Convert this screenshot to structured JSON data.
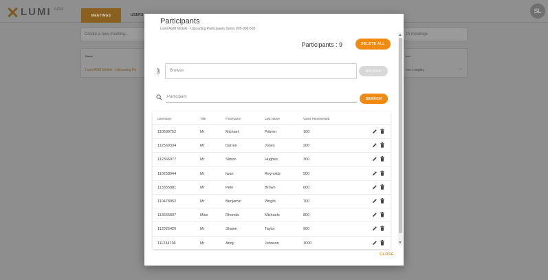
{
  "header": {
    "logo_text": "LUMI",
    "logo_sup": "AGM",
    "nav_meetings": "MEETINGS",
    "nav_users": "USERS",
    "avatar_initials": "SL"
  },
  "background": {
    "search_placeholder": "Create a new meeting...",
    "search_right_placeholder": "th meetings",
    "table_header": "Name",
    "table_row": "Lumi AGM Mobile - Uploading Pa",
    "table_header_right": "iner",
    "table_row_right": "eve Longley",
    "row_menu": "···"
  },
  "modal": {
    "title": "Participants",
    "subtitle": "Lumi AGM Mobile - Uploading Participants Demo 995-999-595",
    "count_label": "Participants : 9",
    "delete_all_label": "DELETE ALL",
    "file_placeholder": "Browse",
    "upload_label": "UPLOAD",
    "search_placeholder": "Participant",
    "search_label": "SEARCH",
    "close_label": "CLOSE"
  },
  "table": {
    "headers": [
      "Usernams",
      "Title",
      "First Name",
      "Last Name",
      "Votes Represented"
    ],
    "rows": [
      {
        "username": "110599752",
        "title": "Mr",
        "first": "Michael",
        "last": "Palmer",
        "votes": "100"
      },
      {
        "username": "112569334",
        "title": "Mr",
        "first": "Darren",
        "last": "Jones",
        "votes": "200"
      },
      {
        "username": "112366977",
        "title": "Mr",
        "first": "Simon",
        "last": "Hughes",
        "votes": "300"
      },
      {
        "username": "110258944",
        "title": "Mr",
        "first": "Iwan",
        "last": "Reynolds",
        "votes": "500"
      },
      {
        "username": "113355881",
        "title": "Mr",
        "first": "Pete",
        "last": "Brown",
        "votes": "600"
      },
      {
        "username": "110478952",
        "title": "Mr",
        "first": "Benjamin",
        "last": "Wright",
        "votes": "700"
      },
      {
        "username": "113656897",
        "title": "Miss",
        "first": "Rhonda",
        "last": "Michaels",
        "votes": "800"
      },
      {
        "username": "112025420",
        "title": "Mr",
        "first": "Shawn",
        "last": "Taylor",
        "votes": "900"
      },
      {
        "username": "111234706",
        "title": "Mr",
        "first": "Andy",
        "last": "Johnson",
        "votes": "1000"
      }
    ]
  },
  "colors": {
    "accent": "#ef8b11",
    "overlay": "#8e8e8e"
  },
  "icons": [
    "paperclip-icon",
    "search-icon",
    "edit-icon",
    "trash-icon"
  ]
}
